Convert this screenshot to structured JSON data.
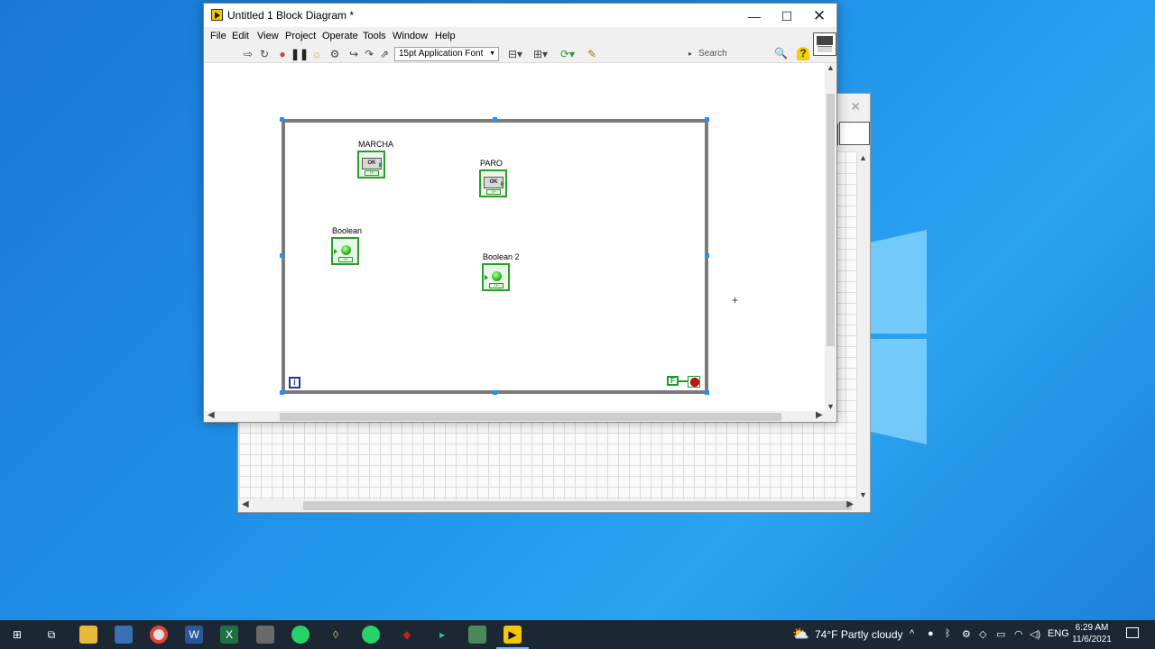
{
  "window": {
    "title": "Untitled 1 Block Diagram *",
    "controls": {
      "minimize": "—",
      "maximize": "☐",
      "close": "✕"
    }
  },
  "menu": [
    "File",
    "Edit",
    "View",
    "Project",
    "Operate",
    "Tools",
    "Window",
    "Help"
  ],
  "toolbar": {
    "font": "15pt Application Font",
    "search_placeholder": "Search",
    "help": "?"
  },
  "diagram": {
    "controls": [
      {
        "label": "MARCHA",
        "button_text": "OK",
        "tf": "TF"
      },
      {
        "label": "PARO",
        "button_text": "OK",
        "tf": "TF"
      }
    ],
    "indicators": [
      {
        "label": "Boolean",
        "tf": "TF"
      },
      {
        "label": "Boolean 2",
        "tf": "TF"
      }
    ],
    "iteration_terminal": "i",
    "condition_tf": "F"
  },
  "front_panel": {
    "close": "✕"
  },
  "taskbar": {
    "weather_temp": "74°F",
    "weather_desc": "Partly cloudy",
    "language": "ENG",
    "time": "6:29 AM",
    "date": "11/6/2021"
  },
  "colors": {
    "desktop": "#1f8fe6",
    "loop_border": "#7a7a7a",
    "boolean_green": "#2c9c2c",
    "taskbar": "#1b2733"
  }
}
